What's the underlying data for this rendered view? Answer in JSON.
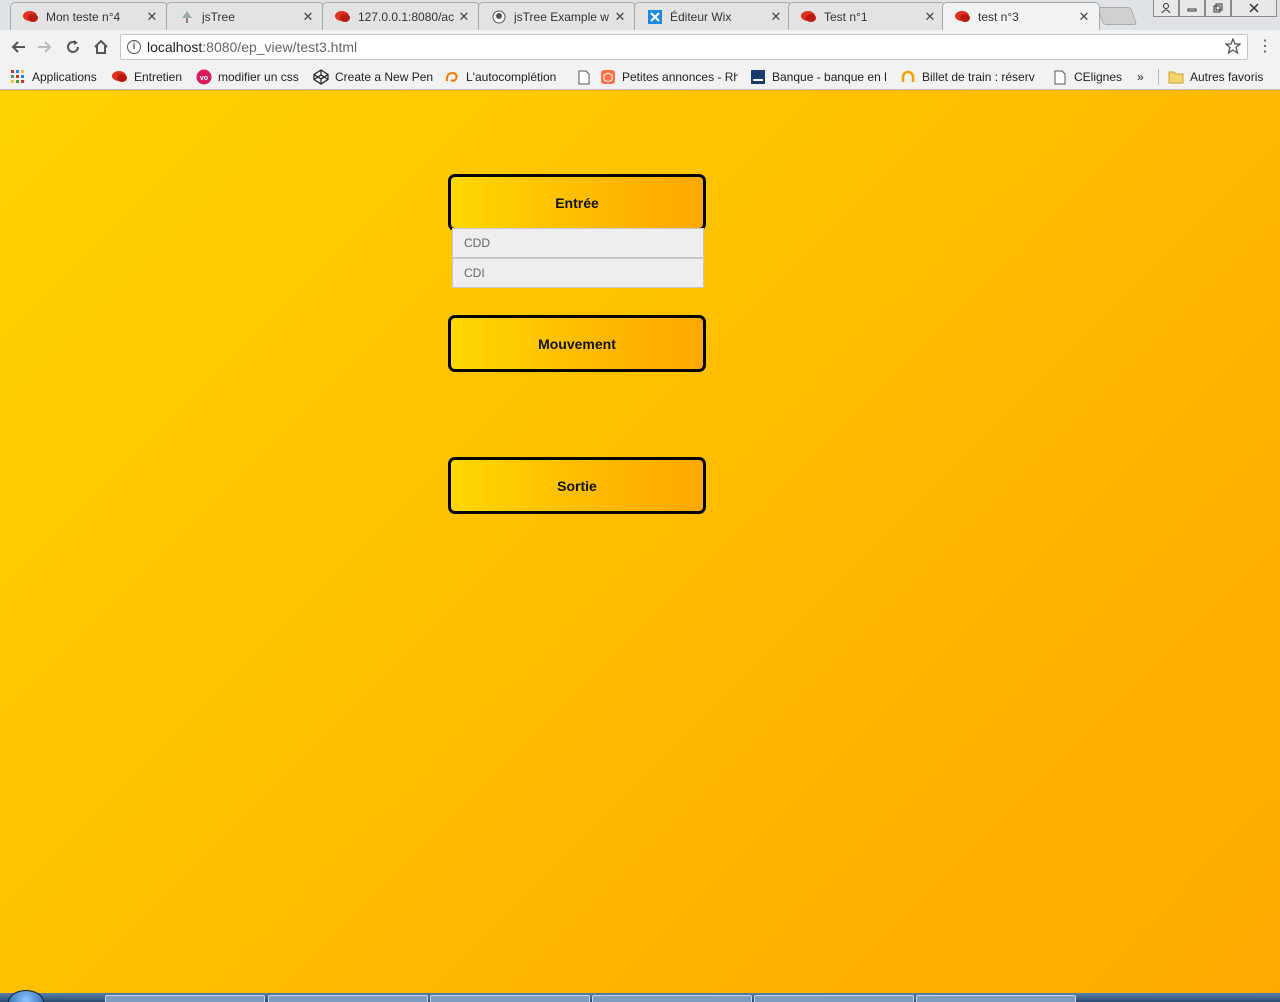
{
  "browser": {
    "tabs": [
      {
        "title": "Mon teste n°4",
        "icon": "speech-bubble-icon",
        "active": false
      },
      {
        "title": "jsTree",
        "icon": "tree-icon",
        "active": false
      },
      {
        "title": "127.0.0.1:8080/ac",
        "icon": "speech-bubble-icon",
        "active": false
      },
      {
        "title": "jsTree Example w",
        "icon": "github-icon",
        "active": false
      },
      {
        "title": "Éditeur Wix",
        "icon": "wix-icon",
        "active": false
      },
      {
        "title": "Test n°1",
        "icon": "speech-bubble-icon",
        "active": false
      },
      {
        "title": "test n°3",
        "icon": "speech-bubble-icon",
        "active": true
      }
    ],
    "close_glyph": "✕",
    "address": {
      "host": "localhost",
      "path": ":8080/ep_view/test3.html"
    },
    "bookmarks": [
      {
        "label": "Applications",
        "icon": "apps-grid-icon"
      },
      {
        "label": "Entretien",
        "icon": "speech-bubble-icon"
      },
      {
        "label": "modifier un css",
        "icon": "vo-icon"
      },
      {
        "label": "Create a New Pen",
        "icon": "codepen-icon"
      },
      {
        "label": "L'autocomplétion",
        "icon": "swirl-icon"
      },
      {
        "label": "Petites annonces - Rh",
        "icon": "page-icon"
      },
      {
        "label": "Banque - banque en l",
        "icon": "bank-icon"
      },
      {
        "label": "Billet de train : réserv",
        "icon": "train-icon"
      },
      {
        "label": "CElignes",
        "icon": "page-icon"
      },
      {
        "label": "»",
        "icon": ""
      },
      {
        "label": "Autres favoris",
        "icon": "folder-icon"
      }
    ],
    "colors": {
      "brand_red": "#e0301e",
      "page_gradient_start": "#ffd400",
      "page_gradient_end": "#ffa900"
    }
  },
  "menu": {
    "entree": {
      "label": "Entrée",
      "items": [
        "CDD",
        "CDI"
      ]
    },
    "mouvement": {
      "label": "Mouvement"
    },
    "sortie": {
      "label": "Sortie"
    }
  }
}
